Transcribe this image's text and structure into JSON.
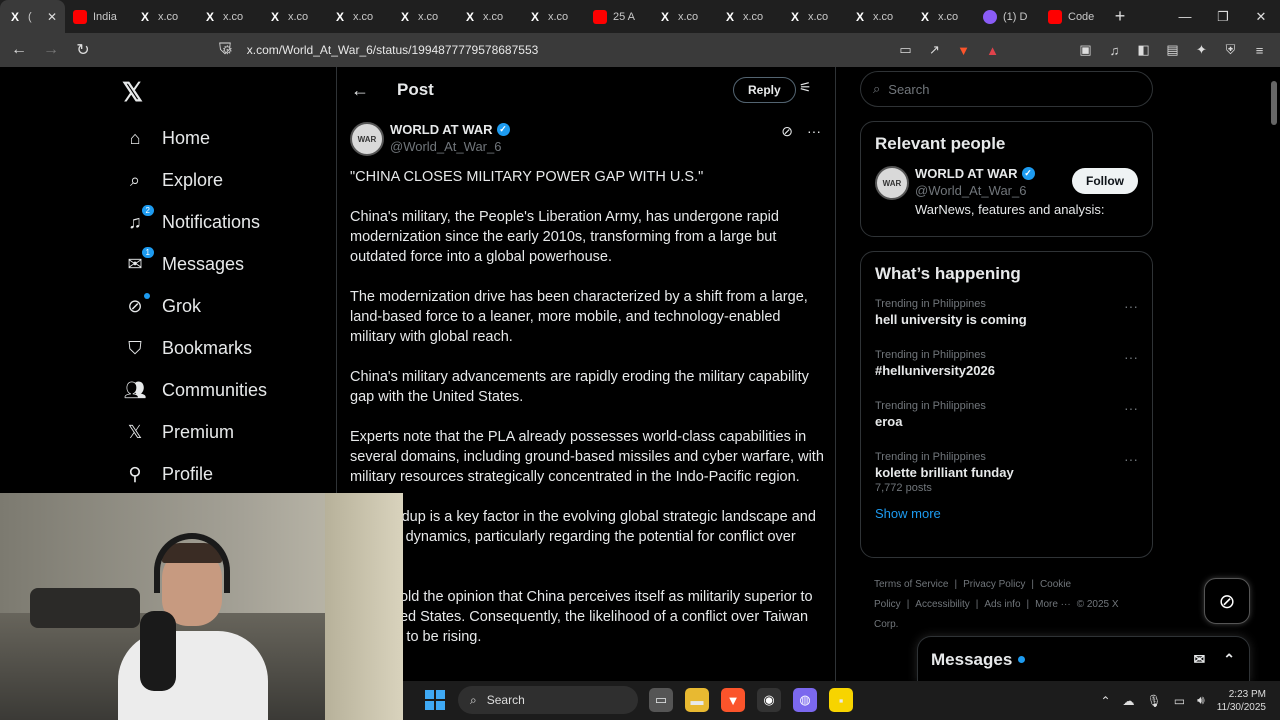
{
  "browser": {
    "tabs": [
      {
        "icon": "X",
        "label": "(",
        "active": true,
        "type": "x"
      },
      {
        "icon": "",
        "label": "India",
        "type": "yt"
      },
      {
        "icon": "X",
        "label": "x.co",
        "type": "x"
      },
      {
        "icon": "X",
        "label": "x.co",
        "type": "x"
      },
      {
        "icon": "X",
        "label": "x.co",
        "type": "x"
      },
      {
        "icon": "X",
        "label": "x.co",
        "type": "x"
      },
      {
        "icon": "X",
        "label": "x.co",
        "type": "x"
      },
      {
        "icon": "X",
        "label": "x.co",
        "type": "x"
      },
      {
        "icon": "X",
        "label": "x.co",
        "type": "x"
      },
      {
        "icon": "",
        "label": "25 A",
        "type": "yt"
      },
      {
        "icon": "X",
        "label": "x.co",
        "type": "x"
      },
      {
        "icon": "X",
        "label": "x.co",
        "type": "x"
      },
      {
        "icon": "X",
        "label": "x.co",
        "type": "x"
      },
      {
        "icon": "X",
        "label": "x.co",
        "type": "x"
      },
      {
        "icon": "X",
        "label": "x.co",
        "type": "x"
      },
      {
        "icon": "",
        "label": "(1) D",
        "type": "gh"
      },
      {
        "icon": "",
        "label": "Code",
        "type": "yt"
      }
    ],
    "url": "x.com/World_At_War_6/status/1994877779578687553",
    "extension_badge": "1"
  },
  "sidebar": {
    "items": [
      {
        "label": "Home",
        "icon": "home-icon"
      },
      {
        "label": "Explore",
        "icon": "search-icon"
      },
      {
        "label": "Notifications",
        "icon": "bell-icon",
        "badge": "2"
      },
      {
        "label": "Messages",
        "icon": "mail-icon",
        "badge": "1"
      },
      {
        "label": "Grok",
        "icon": "grok-icon"
      },
      {
        "label": "Bookmarks",
        "icon": "bookmark-icon"
      },
      {
        "label": "Communities",
        "icon": "people-icon"
      },
      {
        "label": "Premium",
        "icon": "x-icon"
      },
      {
        "label": "Profile",
        "icon": "person-icon"
      }
    ]
  },
  "post": {
    "header_title": "Post",
    "reply_label": "Reply",
    "author_name": "WORLD AT WAR",
    "author_handle": "@World_At_War_6",
    "paragraphs": [
      "\"CHINA CLOSES MILITARY POWER GAP WITH U.S.\"",
      "China's military, the People's Liberation Army, has undergone rapid modernization since the early 2010s, transforming from a large but outdated force into a global powerhouse.",
      "The modernization drive has been characterized by a shift from a large, land-based force to a leaner, more mobile, and technology-enabled military with global reach.",
      "China's military advancements are rapidly eroding the military capability gap with the United States.",
      "Experts note that the PLA already possesses world-class capabilities in several domains, including ground-based missiles and cyber warfare, with military resources strategically concentrated in the Indo-Pacific region.",
      "The buildup is a key factor in the evolving global strategic landscape and regional dynamics, particularly regarding the potential for conflict over Taiwan.",
      "Some hold the opinion that China perceives itself as militarily superior to the United States. Consequently, the likelihood of a conflict over Taiwan appears to be rising."
    ]
  },
  "right": {
    "search_placeholder": "Search",
    "relevant_title": "Relevant people",
    "person_name": "WORLD AT WAR",
    "person_handle": "@World_At_War_6",
    "person_bio": "WarNews, features and analysis:",
    "follow_label": "Follow",
    "happening_title": "What’s happening",
    "trends": [
      {
        "context": "Trending in Philippines",
        "name": "hell university is coming",
        "posts": ""
      },
      {
        "context": "Trending in Philippines",
        "name": "#helluniversity2026",
        "posts": ""
      },
      {
        "context": "Trending in Philippines",
        "name": "eroa",
        "posts": ""
      },
      {
        "context": "Trending in Philippines",
        "name": "kolette brilliant funday",
        "posts": "7,772 posts"
      }
    ],
    "show_more": "Show more",
    "footer_links": [
      "Terms of Service",
      "|",
      "Privacy Policy",
      "|",
      "Cookie Policy",
      "|",
      "Accessibility",
      "|",
      "Ads info",
      "|",
      "More ···",
      "© 2025 X Corp."
    ]
  },
  "messages_drawer": {
    "title": "Messages"
  },
  "taskbar": {
    "search_label": "Search",
    "time": "2:23 PM",
    "date": "11/30/2025"
  },
  "colors": {
    "accent": "#1d9bf0",
    "background": "#000000",
    "border": "#2f3336",
    "muted": "#71767b"
  }
}
